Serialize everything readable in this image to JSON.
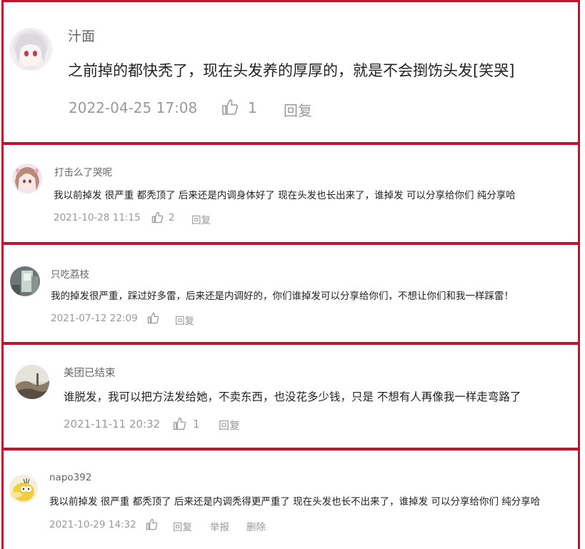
{
  "comments": [
    {
      "username": "汁面",
      "text": "之前掉的都快秃了，现在头发养的厚厚的，就是不会捯饬头发[笑哭]",
      "time": "2022-04-25 17:08",
      "likes": "1",
      "reply_label": "回复",
      "avatar": "anime-girl-white-hair-avatar"
    },
    {
      "username": "打击么了哭呢",
      "text": "我以前掉发 很严重 都秃顶了 后来还是内调身体好了 现在头发也长出来了，谁掉发 可以分享给你们 纯分享哈",
      "time": "2021-10-28 11:15",
      "likes": "2",
      "reply_label": "回复",
      "avatar": "anime-girl-pink-avatar"
    },
    {
      "username": "只吃荔枝",
      "text": "我的掉发很严重，踩过好多雷，后来还是内调好的，你们谁掉发可以分享给你们，不想让你们和我一样踩雷！",
      "time": "2021-07-12 22:09",
      "likes": "",
      "reply_label": "回复",
      "avatar": "window-photo-avatar"
    },
    {
      "username": "美团已结束",
      "text": "谁脱发，我可以把方法发给她，不卖东西，也没花多少钱，只是 不想有人再像我一样走弯路了",
      "time": "2021-11-11 20:32",
      "likes": "1",
      "reply_label": "回复",
      "avatar": "landscape-photo-avatar"
    },
    {
      "username": "napo392",
      "text": "我以前掉发 很严重 都秃顶了 后来还是内调秃得更严重了 现在头发也长不出来了，谁掉发 可以分享给你们 纯分享哈",
      "time": "2021-10-29 14:32",
      "likes": "",
      "reply_label": "回复",
      "report_label": "举报",
      "delete_label": "删除",
      "avatar": "yellow-duck-avatar"
    }
  ],
  "colors": {
    "border": "#c8102e",
    "username": "#666666",
    "text": "#222222",
    "meta": "#999999"
  }
}
